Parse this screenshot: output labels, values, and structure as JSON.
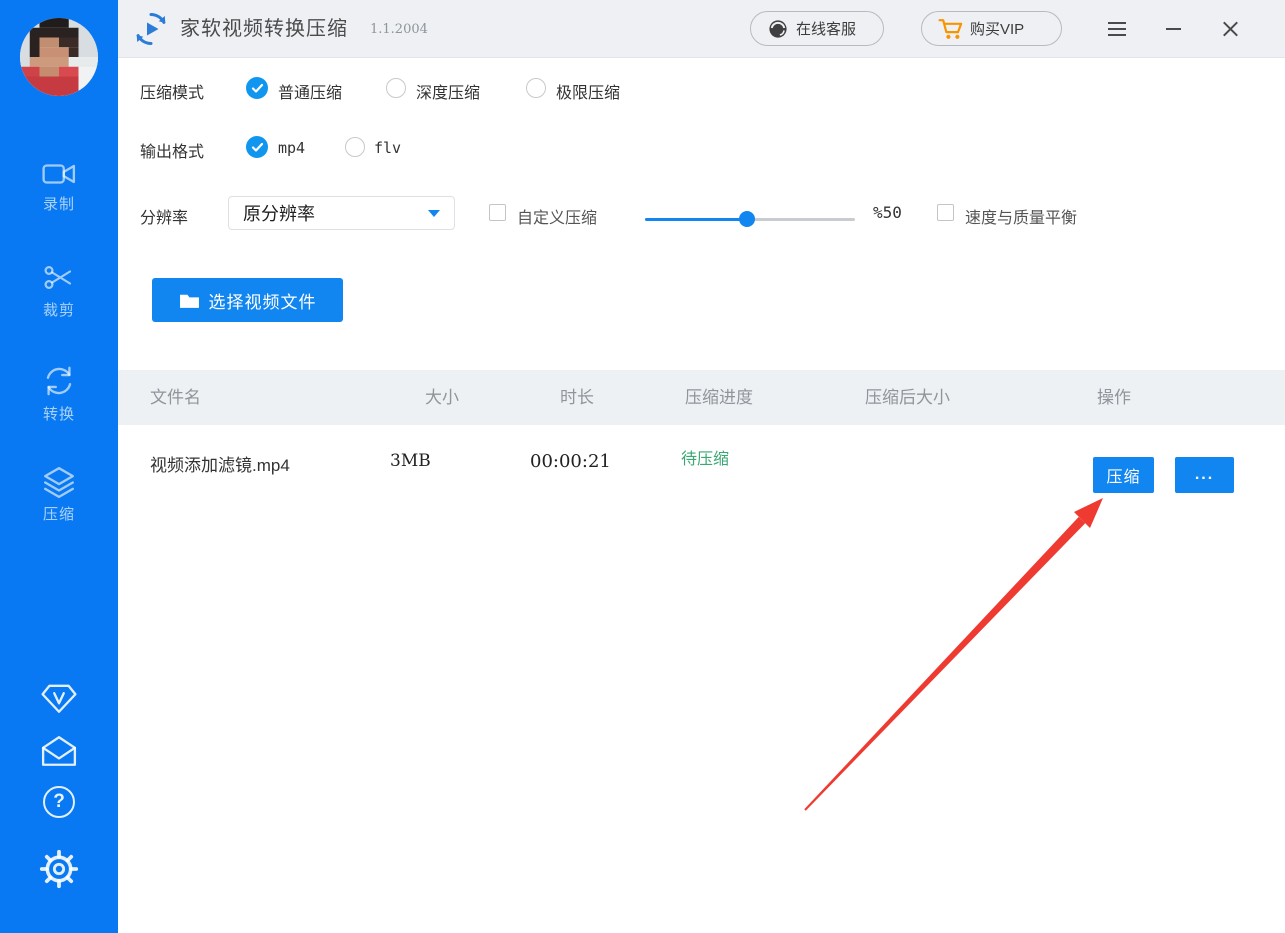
{
  "window": {
    "app_title": "家软视频转换压缩",
    "version": "1.1.2004",
    "support_button": "在线客服",
    "vip_button": "购买VIP"
  },
  "sidebar": {
    "nav": [
      {
        "label": "录制",
        "icon": "video-camera"
      },
      {
        "label": "裁剪",
        "icon": "scissors"
      },
      {
        "label": "转换",
        "icon": "convert-arrows"
      },
      {
        "label": "压缩",
        "icon": "layers"
      }
    ],
    "footer_icons": [
      "vip-diamond",
      "mail",
      "help",
      "settings-gear"
    ],
    "help_glyph": "?"
  },
  "options": {
    "compress_mode_label": "压缩模式",
    "compress_modes": [
      {
        "label": "普通压缩",
        "selected": true
      },
      {
        "label": "深度压缩",
        "selected": false
      },
      {
        "label": "极限压缩",
        "selected": false
      }
    ],
    "output_format_label": "输出格式",
    "output_formats": [
      {
        "label": "mp4",
        "selected": true
      },
      {
        "label": "flv",
        "selected": false
      }
    ],
    "resolution_label": "分辨率",
    "resolution_value": "原分辨率",
    "custom_compress_label": "自定义压缩",
    "custom_compress_checked": false,
    "slider_value_label": "%50",
    "slider_percent": 50,
    "balance_label": "速度与质量平衡",
    "balance_checked": false,
    "select_file_button": "选择视频文件"
  },
  "table": {
    "headers": [
      "文件名",
      "大小",
      "时长",
      "压缩进度",
      "压缩后大小",
      "操作"
    ],
    "rows": [
      {
        "filename": "视频添加滤镜.mp4",
        "size": "3MB",
        "duration": "00:00:21",
        "status": "待压缩",
        "compressed_size": "",
        "actions": {
          "compress": "压缩",
          "more": "..."
        }
      }
    ]
  },
  "colors": {
    "sidebar_blue": "#0879f2",
    "accent_blue": "#1286f0",
    "status_green": "#3aa873",
    "vip_orange": "#f79400",
    "arrow_red": "#ee3a30"
  }
}
